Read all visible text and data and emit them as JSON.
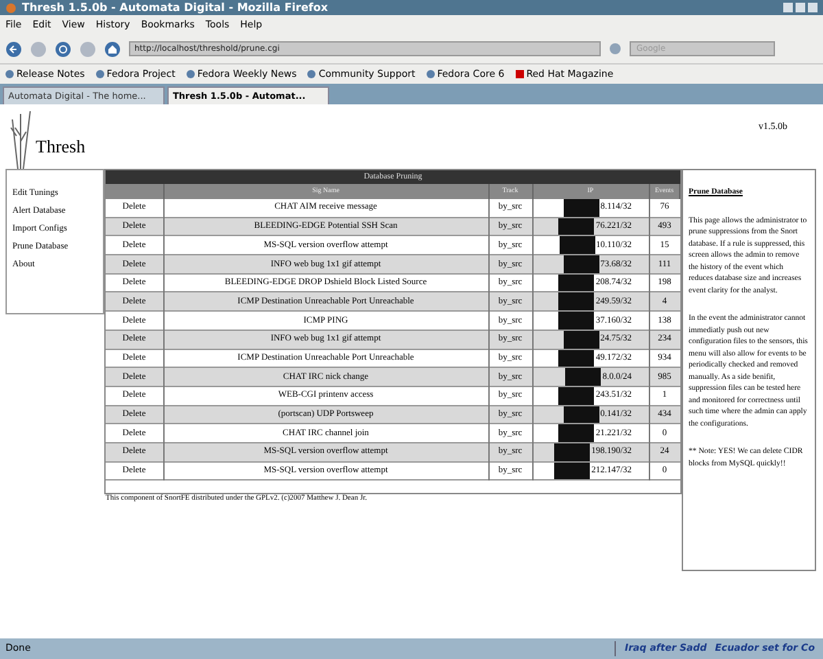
{
  "window": {
    "title": "Thresh 1.5.0b - Automata Digital - Mozilla Firefox"
  },
  "menu": [
    "File",
    "Edit",
    "View",
    "History",
    "Bookmarks",
    "Tools",
    "Help"
  ],
  "address": {
    "value": "http://localhost/threshold/prune.cgi"
  },
  "search": {
    "placeholder": "Google"
  },
  "bookmarks": [
    "Release Notes",
    "Fedora Project",
    "Fedora Weekly News",
    "Community Support",
    "Fedora Core 6",
    "Red Hat Magazine"
  ],
  "tabs": [
    {
      "label": "Automata Digital - The home...",
      "selected": false
    },
    {
      "label": "Thresh 1.5.0b - Automat...",
      "selected": true
    }
  ],
  "page": {
    "logo": "Thresh",
    "version": "v1.5.0b",
    "sidebar": {
      "items": [
        "Edit Tunings",
        "Alert Database",
        "Import Configs",
        "Prune Database",
        "About"
      ]
    },
    "table": {
      "title": "Database Pruning",
      "columns": [
        "Sig Name",
        "Track",
        "IP",
        "Events"
      ],
      "rows": [
        {
          "action": "Delete",
          "sig": "CHAT AIM receive message",
          "track": "by_src",
          "ip": "8.114/32",
          "events": "76"
        },
        {
          "action": "Delete",
          "sig": "BLEEDING-EDGE Potential SSH Scan",
          "track": "by_src",
          "ip": "76.221/32",
          "events": "493"
        },
        {
          "action": "Delete",
          "sig": "MS-SQL version overflow attempt",
          "track": "by_src",
          "ip": "10.110/32",
          "events": "15"
        },
        {
          "action": "Delete",
          "sig": "INFO web bug 1x1 gif attempt",
          "track": "by_src",
          "ip": "73.68/32",
          "events": "111"
        },
        {
          "action": "Delete",
          "sig": "BLEEDING-EDGE DROP Dshield Block Listed Source",
          "track": "by_src",
          "ip": "208.74/32",
          "events": "198"
        },
        {
          "action": "Delete",
          "sig": "ICMP Destination Unreachable Port Unreachable",
          "track": "by_src",
          "ip": "249.59/32",
          "events": "4"
        },
        {
          "action": "Delete",
          "sig": "ICMP PING",
          "track": "by_src",
          "ip": "37.160/32",
          "events": "138"
        },
        {
          "action": "Delete",
          "sig": "INFO web bug 1x1 gif attempt",
          "track": "by_src",
          "ip": "24.75/32",
          "events": "234"
        },
        {
          "action": "Delete",
          "sig": "ICMP Destination Unreachable Port Unreachable",
          "track": "by_src",
          "ip": "49.172/32",
          "events": "934"
        },
        {
          "action": "Delete",
          "sig": "CHAT IRC nick change",
          "track": "by_src",
          "ip": "8.0.0/24",
          "events": "985"
        },
        {
          "action": "Delete",
          "sig": "WEB-CGI printenv access",
          "track": "by_src",
          "ip": "243.51/32",
          "events": "1"
        },
        {
          "action": "Delete",
          "sig": "(portscan) UDP Portsweep",
          "track": "by_src",
          "ip": "0.141/32",
          "events": "434"
        },
        {
          "action": "Delete",
          "sig": "CHAT IRC channel join",
          "track": "by_src",
          "ip": "21.221/32",
          "events": "0"
        },
        {
          "action": "Delete",
          "sig": "MS-SQL version overflow attempt",
          "track": "by_src",
          "ip": "198.190/32",
          "events": "24"
        },
        {
          "action": "Delete",
          "sig": "MS-SQL version overflow attempt",
          "track": "by_src",
          "ip": "212.147/32",
          "events": "0"
        }
      ],
      "footer": "This component of SnortFE distributed under the GPLv2. (c)2007 Matthew J. Dean Jr."
    },
    "help": {
      "heading": "Prune Database",
      "paragraphs": [
        "This page allows the administrator to prune suppressions from the Snort database. If a rule is suppressed, this screen allows the admin to remove the history of the event which reduces database size and increases event clarity for the analyst.",
        "In the event the administrator cannot immediatly push out new configuration files to the sensors, this menu will also allow for events to be periodically checked and removed manually. As a side benifit, suppression files can be tested here and monitored for correctness until such time where the admin can apply the configurations.",
        "** Note: YES! We can delete CIDR blocks from MySQL quickly!!"
      ]
    }
  },
  "status_bar": {
    "text": "Done",
    "news": [
      "Iraq after Sadd",
      "Ecuador set for Co"
    ]
  }
}
